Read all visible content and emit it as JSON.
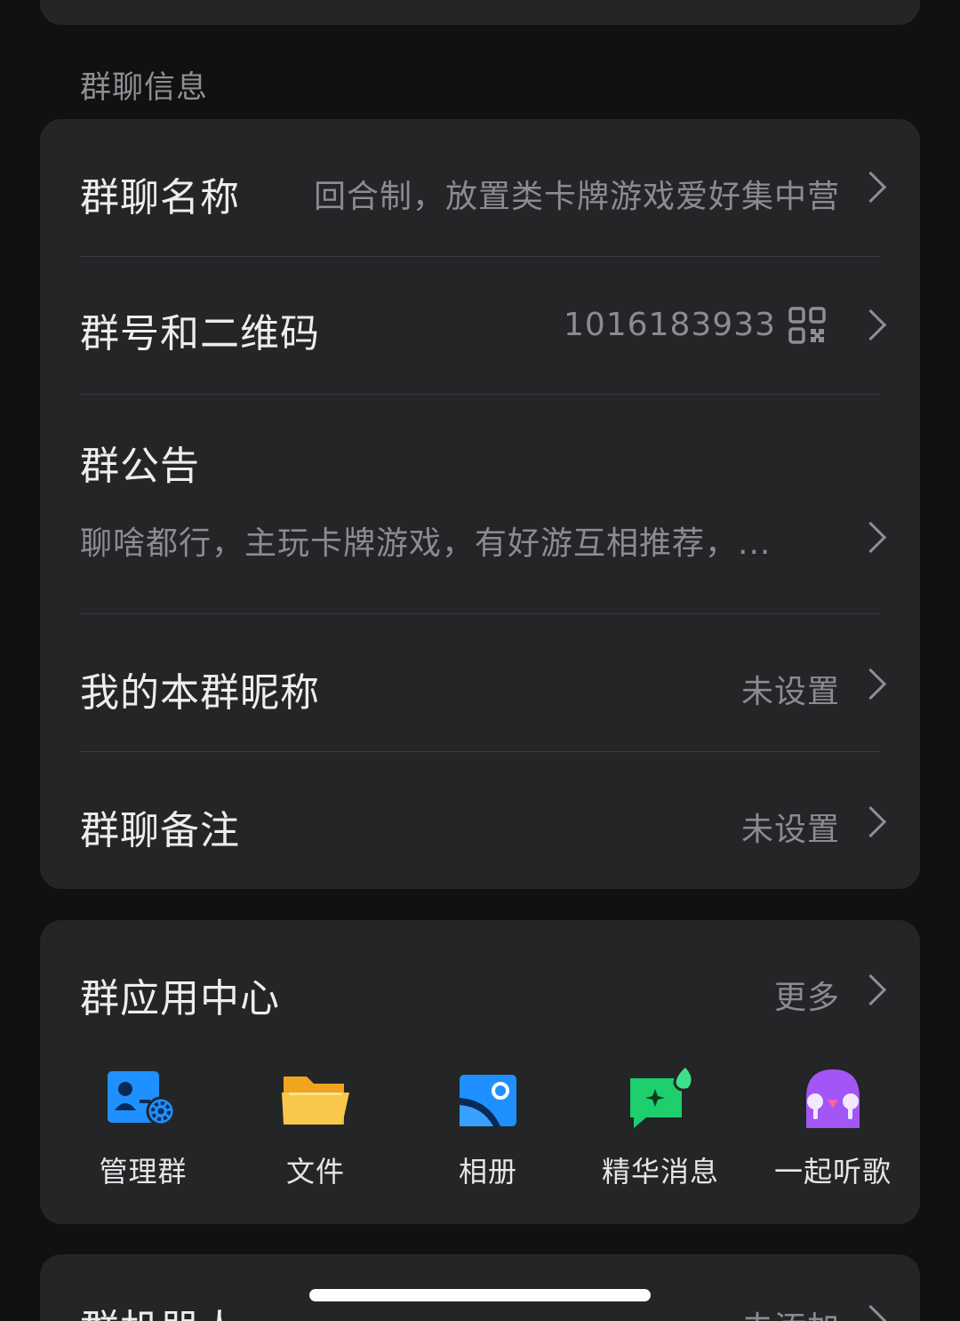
{
  "section": {
    "group_info_label": "群聊信息"
  },
  "rows": {
    "name": {
      "title": "群聊名称",
      "value": "回合制，放置类卡牌游戏爱好集中营"
    },
    "number": {
      "title": "群号和二维码",
      "value": "1016183933"
    },
    "notice": {
      "title": "群公告",
      "value": "聊啥都行，主玩卡牌游戏，有好游互相推荐，..."
    },
    "nickname": {
      "title": "我的本群昵称",
      "value": "未设置"
    },
    "remark": {
      "title": "群聊备注",
      "value": "未设置"
    }
  },
  "app_center": {
    "title": "群应用中心",
    "more": "更多",
    "apps": [
      {
        "label": "管理群",
        "icon": "manage-group-icon"
      },
      {
        "label": "文件",
        "icon": "folder-icon"
      },
      {
        "label": "相册",
        "icon": "album-icon"
      },
      {
        "label": "精华消息",
        "icon": "essence-message-icon"
      },
      {
        "label": "一起听歌",
        "icon": "listen-together-icon"
      }
    ]
  },
  "robot": {
    "title": "群机器人",
    "value": "去添加"
  },
  "colors": {
    "background": "#111112",
    "card": "#242527",
    "blue": "#1e90ff",
    "yellow": "#f7b731",
    "green": "#1ecf6e",
    "purple": "#a156f5"
  }
}
